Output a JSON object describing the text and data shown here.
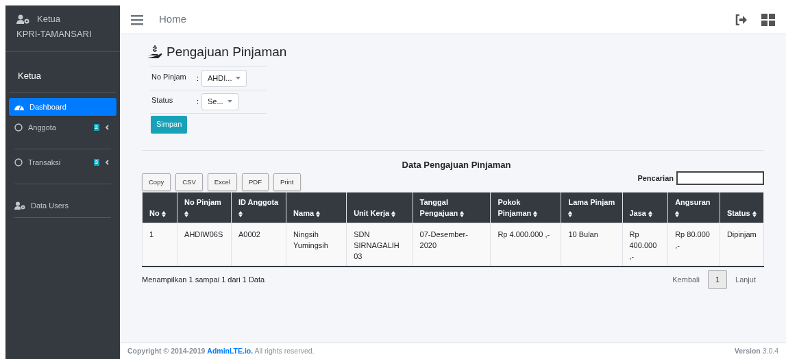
{
  "sidebar": {
    "brand_line1": "Ketua",
    "brand_line2": "KPRI-TAMANSARI",
    "user": "Ketua",
    "items": [
      {
        "kind": "gauge",
        "label": "Dashboard",
        "selected": true
      },
      {
        "kind": "circle",
        "label": "Anggota",
        "badge": "2",
        "selected": false,
        "expanded": false
      },
      {
        "kind": "circle",
        "label": "Transaksi",
        "badge": "3",
        "selected": false,
        "expanded": false
      },
      {
        "kind": "users",
        "label": "Data Users",
        "selected": false
      }
    ]
  },
  "navbar": {
    "title": "Home"
  },
  "page_title": "Pengajuan Pinjaman",
  "form": [
    {
      "label": "No Pinjam",
      "separator": ":",
      "value": "AHDI..."
    },
    {
      "label": "Status",
      "separator": ":",
      "value": "Se..."
    }
  ],
  "save_button": "Simpan",
  "table_title": "Data Pengajuan Pinjaman",
  "export_buttons": [
    "Copy",
    "CSV",
    "Excel",
    "PDF",
    "Print"
  ],
  "search_label": "Pencarian",
  "table": {
    "columns": [
      "No",
      "No Pinjam",
      "ID Anggota",
      "Nama",
      "Unit Kerja",
      "Tanggal Pengajuan",
      "Pokok Pinjaman",
      "Lama Pinjam",
      "Jasa",
      "Angsuran",
      "Status"
    ],
    "rows": [
      [
        "1",
        "AHDIW06S",
        "A0002",
        "Ningsih Yumingsih",
        "SDN SIRNAGALIH 03",
        "07-Desember-2020",
        "Rp 4.000.000 ,-",
        "10 Bulan",
        "Rp 400.000 ,-",
        "Rp 80.000 ,-",
        "Dipinjam"
      ]
    ]
  },
  "info": "Menampilkan 1 sampai 1 dari 1 Data",
  "pagination": {
    "prev": "Kembali",
    "pages": [
      {
        "label": "1",
        "selected": true
      }
    ],
    "next": "Lanjut"
  },
  "footer": {
    "copyright": "**Copyright © 2014-2019**",
    "link": "AdminLTE.io.",
    "rights": "All rights reserved.",
    "version": "**Version** 3.0.4"
  }
}
